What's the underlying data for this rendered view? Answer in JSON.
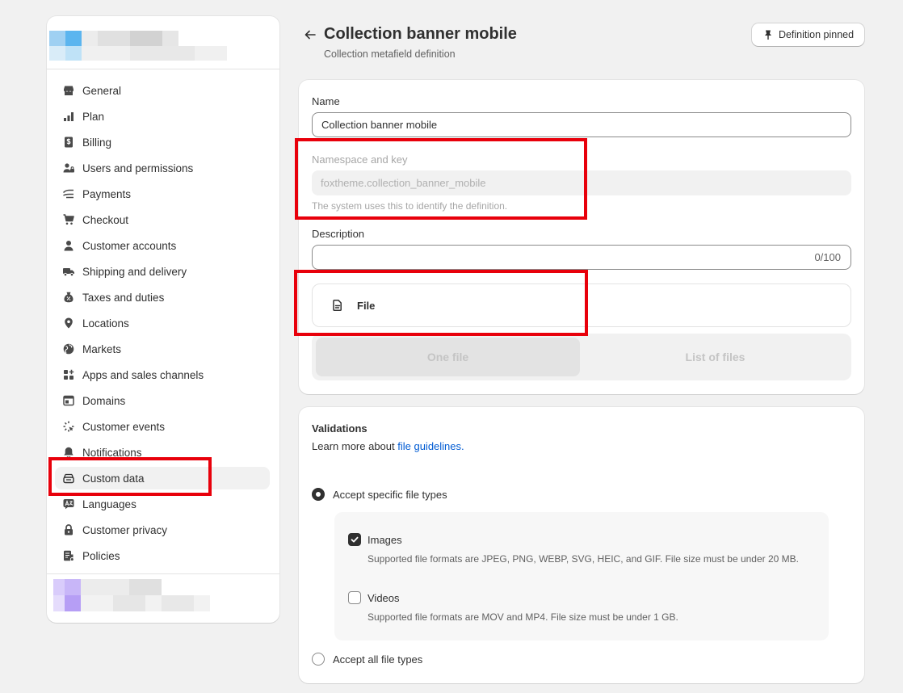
{
  "sidebar": {
    "items": [
      {
        "label": "General",
        "icon": "store-icon"
      },
      {
        "label": "Plan",
        "icon": "plan-icon"
      },
      {
        "label": "Billing",
        "icon": "billing-icon"
      },
      {
        "label": "Users and permissions",
        "icon": "users-icon"
      },
      {
        "label": "Payments",
        "icon": "payments-icon"
      },
      {
        "label": "Checkout",
        "icon": "cart-icon"
      },
      {
        "label": "Customer accounts",
        "icon": "person-icon"
      },
      {
        "label": "Shipping and delivery",
        "icon": "truck-icon"
      },
      {
        "label": "Taxes and duties",
        "icon": "tax-icon"
      },
      {
        "label": "Locations",
        "icon": "location-icon"
      },
      {
        "label": "Markets",
        "icon": "globe-icon"
      },
      {
        "label": "Apps and sales channels",
        "icon": "apps-icon"
      },
      {
        "label": "Domains",
        "icon": "domains-icon"
      },
      {
        "label": "Customer events",
        "icon": "cursor-icon"
      },
      {
        "label": "Notifications",
        "icon": "bell-icon"
      },
      {
        "label": "Custom data",
        "icon": "custom-data-icon",
        "active": true
      },
      {
        "label": "Languages",
        "icon": "language-icon"
      },
      {
        "label": "Customer privacy",
        "icon": "lock-icon"
      },
      {
        "label": "Policies",
        "icon": "policies-icon"
      }
    ]
  },
  "header": {
    "title": "Collection banner mobile",
    "subtitle": "Collection metafield definition",
    "pin_label": "Definition pinned"
  },
  "form": {
    "name_label": "Name",
    "name_value": "Collection banner mobile",
    "namespace_label": "Namespace and key",
    "namespace_value": "foxtheme.collection_banner_mobile",
    "namespace_help": "The system uses this to identify the definition.",
    "description_label": "Description",
    "description_value": "",
    "description_counter": "0/100",
    "type_label": "File",
    "type_icon": "file-icon",
    "option_one": "One file",
    "option_list": "List of files"
  },
  "validations": {
    "title": "Validations",
    "learn_prefix": "Learn more about ",
    "learn_link": "file guidelines.",
    "radio_specific": "Accept specific file types",
    "images_label": "Images",
    "images_help": "Supported file formats are JPEG, PNG, WEBP, SVG, HEIC, and GIF. File size must be under 20 MB.",
    "videos_label": "Videos",
    "videos_help": "Supported file formats are MOV and MP4. File size must be under 1 GB.",
    "radio_all": "Accept all file types",
    "images_checked": true,
    "videos_checked": false,
    "specific_selected": true
  },
  "colors": {
    "highlight": "#e8000b",
    "link": "#005bd3",
    "background": "#f1f1f1"
  }
}
